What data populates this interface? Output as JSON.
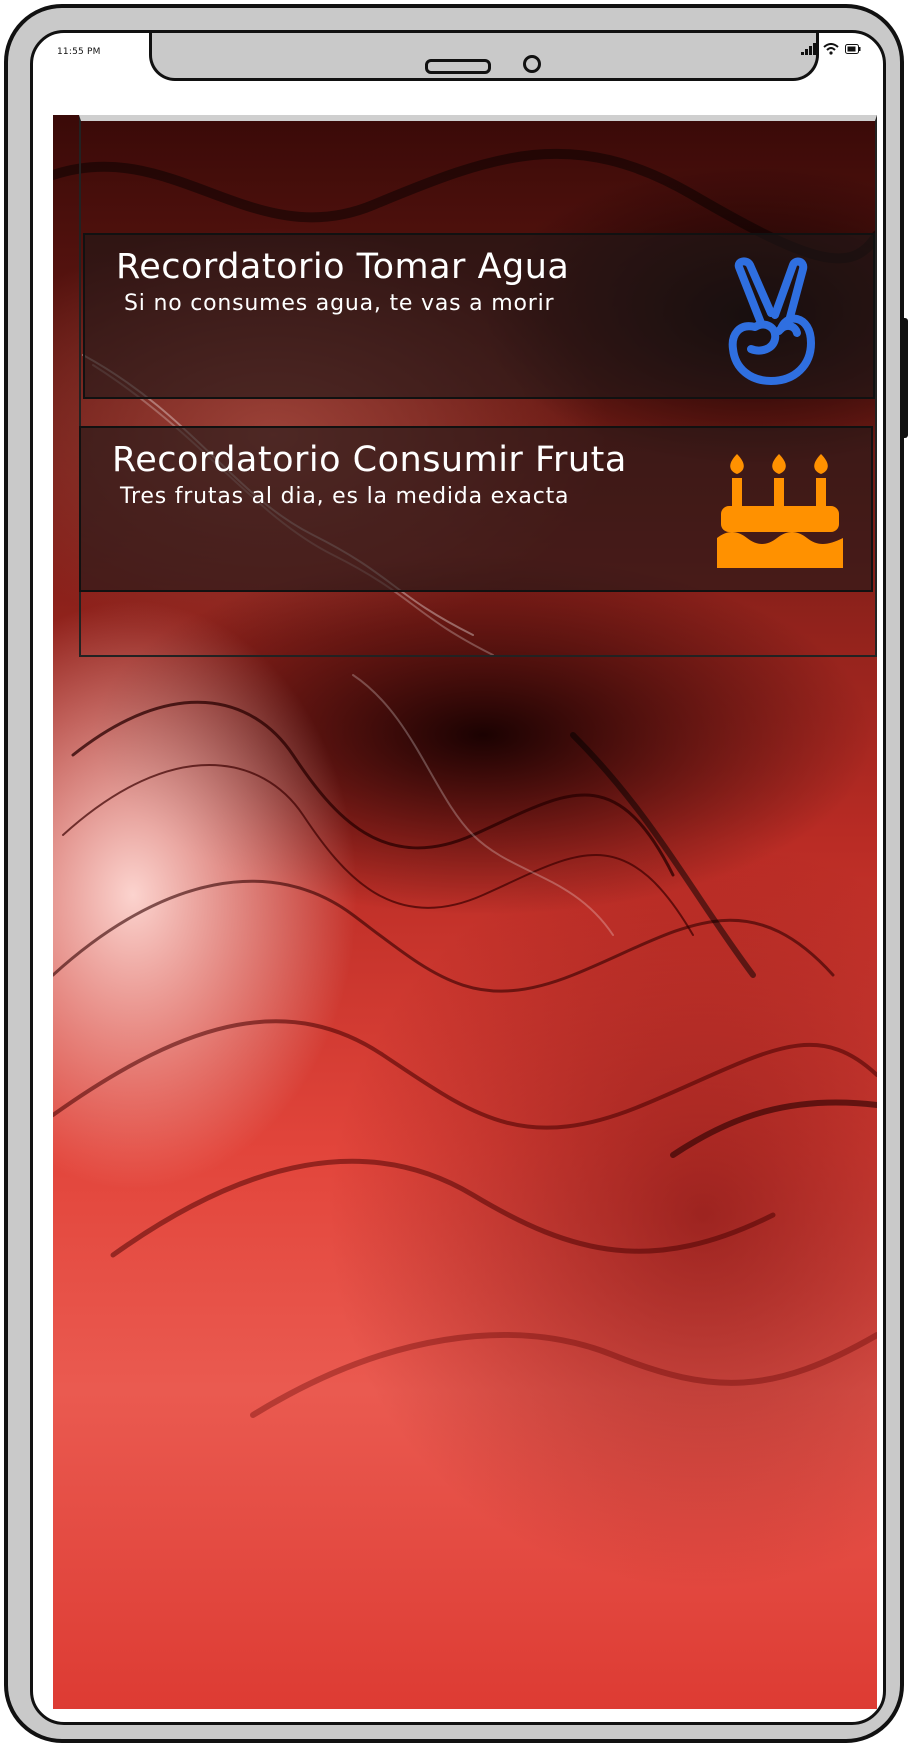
{
  "status_bar": {
    "time": "11:55 PM",
    "icons": [
      "signal-icon",
      "wifi-icon",
      "battery-icon"
    ]
  },
  "notifications": [
    {
      "title": "Recordatorio Tomar Agua",
      "subtitle": "Si no consumes agua, te vas a morir",
      "icon": "peace-hand-icon",
      "icon_color": "#2f6fe0"
    },
    {
      "title": "Recordatorio Consumir Fruta",
      "subtitle": "Tres frutas al dia, es la medida exacta",
      "icon": "birthday-cake-icon",
      "icon_color": "#ff9100"
    }
  ],
  "colors": {
    "frame": "#c9c9c9",
    "wallpaper_accent": "#e2453b"
  }
}
